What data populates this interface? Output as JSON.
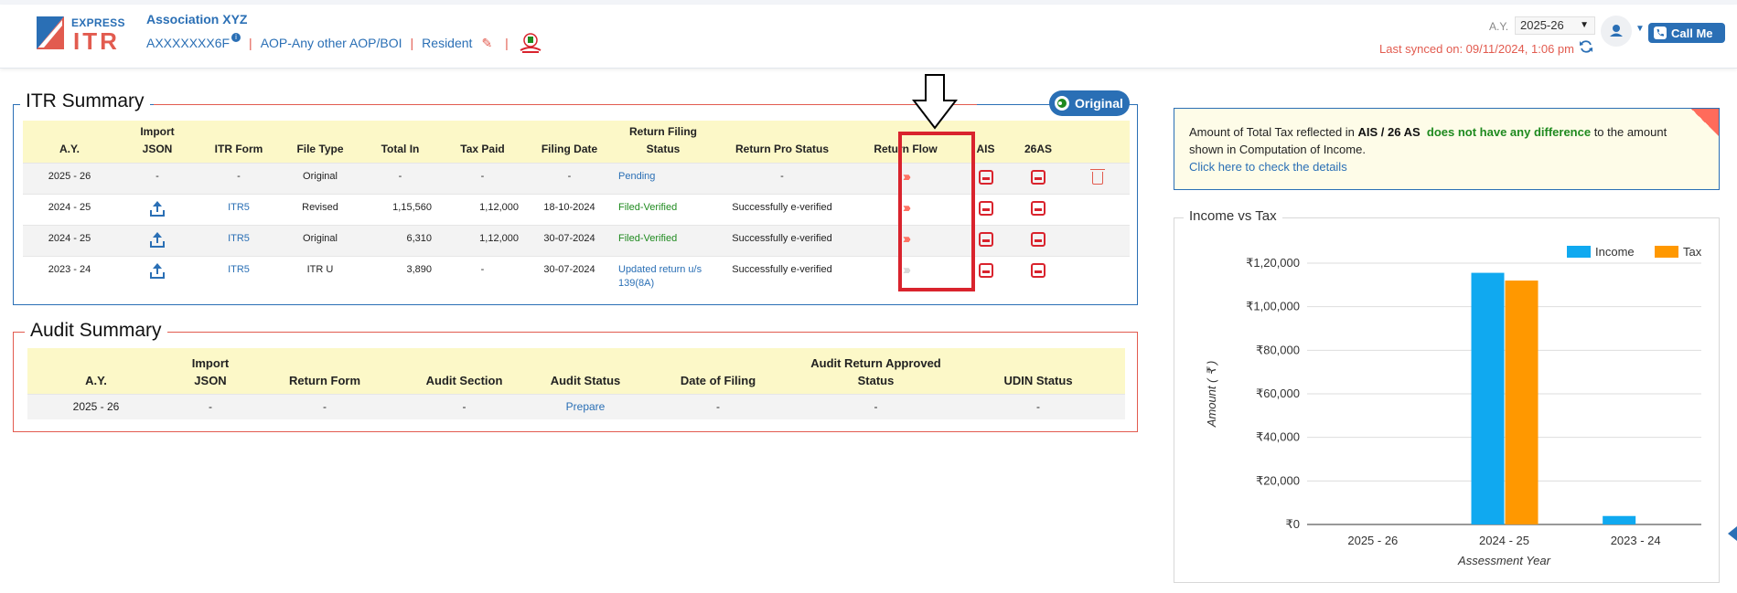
{
  "header": {
    "logo_top": "EXPRESS",
    "logo_bottom": "ITR",
    "client_name": "Association XYZ",
    "pan": "AXXXXXXX6F",
    "info_badge": "i",
    "status_type": "AOP-Any other AOP/BOI",
    "residency": "Resident",
    "ay_label": "A.Y.",
    "ay_value": "2025-26",
    "last_synced": "Last synced on: 09/11/2024, 1:06 pm",
    "call_me": "Call Me"
  },
  "itr_summary": {
    "title": "ITR Summary",
    "badge": "Original",
    "columns": [
      {
        "line1": "",
        "line2": "A.Y."
      },
      {
        "line1": "Import",
        "line2": "JSON"
      },
      {
        "line1": "",
        "line2": "ITR Form"
      },
      {
        "line1": "",
        "line2": "File Type"
      },
      {
        "line1": "",
        "line2": "Total In"
      },
      {
        "line1": "",
        "line2": "Tax Paid"
      },
      {
        "line1": "",
        "line2": "Filing Date"
      },
      {
        "line1": "Return Filing",
        "line2": "Status"
      },
      {
        "line1": "",
        "line2": "Return Pro Status"
      },
      {
        "line1": "",
        "line2": "Return Flow"
      },
      {
        "line1": "",
        "line2": "AIS"
      },
      {
        "line1": "",
        "line2": "26AS"
      },
      {
        "line1": "",
        "line2": ""
      }
    ],
    "rows": [
      {
        "ay": "2025 - 26",
        "import": "-",
        "form": "-",
        "file_type": "Original",
        "total_in": "-",
        "tax_paid": "-",
        "filing_date": "-",
        "filing_status": "Pending",
        "pro_status": "-"
      },
      {
        "ay": "2024 - 25",
        "import": "",
        "form": "ITR5",
        "file_type": "Revised",
        "total_in": "1,15,560",
        "tax_paid": "1,12,000",
        "filing_date": "18-10-2024",
        "filing_status": "Filed-Verified",
        "pro_status": "Successfully e-verified"
      },
      {
        "ay": "2024 - 25",
        "import": "",
        "form": "ITR5",
        "file_type": "Original",
        "total_in": "6,310",
        "tax_paid": "1,12,000",
        "filing_date": "30-07-2024",
        "filing_status": "Filed-Verified",
        "pro_status": "Successfully e-verified"
      },
      {
        "ay": "2023 - 24",
        "import": "",
        "form": "ITR5",
        "file_type": "ITR U",
        "total_in": "3,890",
        "tax_paid": "-",
        "filing_date": "30-07-2024",
        "filing_status": "Updated return u/s 139(8A)",
        "pro_status": "Successfully e-verified"
      }
    ]
  },
  "audit_summary": {
    "title": "Audit Summary",
    "columns": [
      {
        "line1": "",
        "line2": "A.Y."
      },
      {
        "line1": "Import",
        "line2": "JSON"
      },
      {
        "line1": "",
        "line2": "Return Form"
      },
      {
        "line1": "",
        "line2": "Audit Section"
      },
      {
        "line1": "",
        "line2": "Audit Status"
      },
      {
        "line1": "",
        "line2": "Date of Filing"
      },
      {
        "line1": "Audit Return Approved",
        "line2": "Status"
      },
      {
        "line1": "",
        "line2": "UDIN Status"
      }
    ],
    "rows": [
      {
        "ay": "2025 - 26",
        "import": "-",
        "form": "-",
        "section": "-",
        "status": "Prepare",
        "date": "-",
        "approved": "-",
        "udin": "-"
      }
    ]
  },
  "notice": {
    "part1": "Amount of Total Tax reflected in ",
    "bold": "AIS / 26 AS",
    "highlight": "does not have any difference",
    "part2": " to the amount shown in Computation of Income.",
    "link": "Click here to check the details"
  },
  "chart_data": {
    "type": "bar",
    "title": "Income vs Tax",
    "xlabel": "Assessment Year",
    "ylabel": "Amount ( ₹ )",
    "categories": [
      "2025 - 26",
      "2024 - 25",
      "2023 - 24"
    ],
    "series": [
      {
        "name": "Income",
        "values": [
          0,
          115560,
          3890
        ],
        "color": "#10a9f0"
      },
      {
        "name": "Tax",
        "values": [
          0,
          112000,
          0
        ],
        "color": "#ff9800"
      }
    ],
    "ylim": [
      0,
      120000
    ],
    "yticks": [
      0,
      20000,
      40000,
      60000,
      80000,
      100000,
      120000
    ],
    "ytick_labels": [
      "₹0",
      "₹20,000",
      "₹40,000",
      "₹60,000",
      "₹80,000",
      "₹1,00,000",
      "₹1,20,000"
    ],
    "grid": true,
    "legend": "top-right"
  },
  "colors": {
    "brand_blue": "#2a6fb5",
    "brand_red": "#e25b4f",
    "header_yellow": "#fcf8c8",
    "highlight_red": "#d9232d"
  }
}
